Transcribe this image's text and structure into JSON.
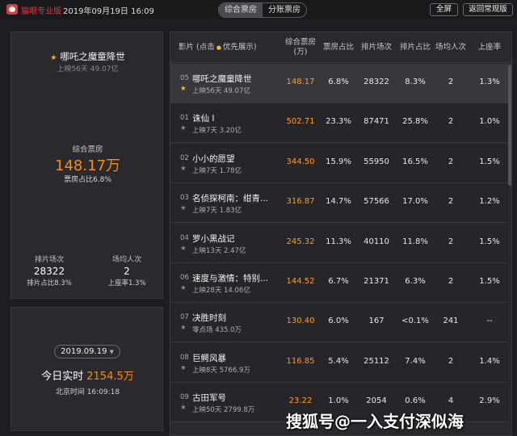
{
  "app": {
    "name": "猫眼专业版",
    "datetime": "2019年09月19日 16:09"
  },
  "tabs": [
    {
      "label": "综合票房"
    },
    {
      "label": "分账票房"
    }
  ],
  "buttons": {
    "fullscreen": "全屏",
    "back": "返回常规版"
  },
  "selected_movie": {
    "title": "哪吒之魔童降世",
    "sub": "上映56天 49.07亿",
    "box_office_label": "综合票房",
    "box_office_value": "148.17万",
    "box_office_share": "票房占比6.8%",
    "screenings_label": "排片场次",
    "screenings_value": "28322",
    "screenings_share": "排片占比8.3%",
    "avg_label": "场均人次",
    "avg_value": "2",
    "occupancy": "上座率1.3%"
  },
  "today": {
    "date": "2019.09.19",
    "realtime_label": "今日实时",
    "realtime_value": "2154.5万",
    "beijing_time": "北京时间 16:09:18"
  },
  "table": {
    "headers": {
      "film_prefix": "影片 (点击",
      "film_suffix": "优先展示)",
      "box": "综合票房\n(万)",
      "box_share": "票房占比",
      "screenings": "排片场次",
      "screen_share": "排片占比",
      "avg": "场均人次",
      "occupancy": "上座率"
    },
    "rows": [
      {
        "rank": "05",
        "title": "哪吒之魔童降世",
        "meta": "上映56天 49.07亿",
        "box": "148.17",
        "box_share": "6.8%",
        "screenings": "28322",
        "screen_share": "8.3%",
        "avg": "2",
        "occupancy": "1.3%",
        "starred": true
      },
      {
        "rank": "01",
        "title": "诛仙 Ⅰ",
        "meta": "上映7天 3.20亿",
        "box": "502.71",
        "box_share": "23.3%",
        "screenings": "87471",
        "screen_share": "25.8%",
        "avg": "2",
        "occupancy": "1.0%",
        "starred": false
      },
      {
        "rank": "02",
        "title": "小小的愿望",
        "meta": "上映7天 1.78亿",
        "box": "344.50",
        "box_share": "15.9%",
        "screenings": "55950",
        "screen_share": "16.5%",
        "avg": "2",
        "occupancy": "1.5%",
        "starred": false
      },
      {
        "rank": "03",
        "title": "名侦探柯南：绀青...",
        "meta": "上映7天 1.83亿",
        "box": "316.87",
        "box_share": "14.7%",
        "screenings": "57566",
        "screen_share": "17.0%",
        "avg": "2",
        "occupancy": "1.2%",
        "starred": false
      },
      {
        "rank": "04",
        "title": "罗小黑战记",
        "meta": "上映13天 2.47亿",
        "box": "245.32",
        "box_share": "11.3%",
        "screenings": "40110",
        "screen_share": "11.8%",
        "avg": "2",
        "occupancy": "1.5%",
        "starred": false
      },
      {
        "rank": "06",
        "title": "速度与激情：特别...",
        "meta": "上映28天 14.06亿",
        "box": "144.52",
        "box_share": "6.7%",
        "screenings": "21371",
        "screen_share": "6.3%",
        "avg": "2",
        "occupancy": "1.5%",
        "starred": false
      },
      {
        "rank": "07",
        "title": "决胜时刻",
        "meta": "零点场 435.0万",
        "box": "130.40",
        "box_share": "6.0%",
        "screenings": "167",
        "screen_share": "<0.1%",
        "avg": "241",
        "occupancy": "--",
        "starred": false
      },
      {
        "rank": "08",
        "title": "巨鳄风暴",
        "meta": "上映8天 5766.9万",
        "box": "116.85",
        "box_share": "5.4%",
        "screenings": "25112",
        "screen_share": "7.4%",
        "avg": "2",
        "occupancy": "1.4%",
        "starred": false
      },
      {
        "rank": "09",
        "title": "古田军号",
        "meta": "上映50天 2799.8万",
        "box": "23.22",
        "box_share": "1.0%",
        "screenings": "2054",
        "screen_share": "0.6%",
        "avg": "4",
        "occupancy": "2.9%",
        "starred": false
      }
    ]
  },
  "watermark": "搜狐号@一入支付深似海",
  "colors": {
    "accent": "#ff8a00",
    "brand": "#e2353f",
    "star": "#f5b82e"
  }
}
